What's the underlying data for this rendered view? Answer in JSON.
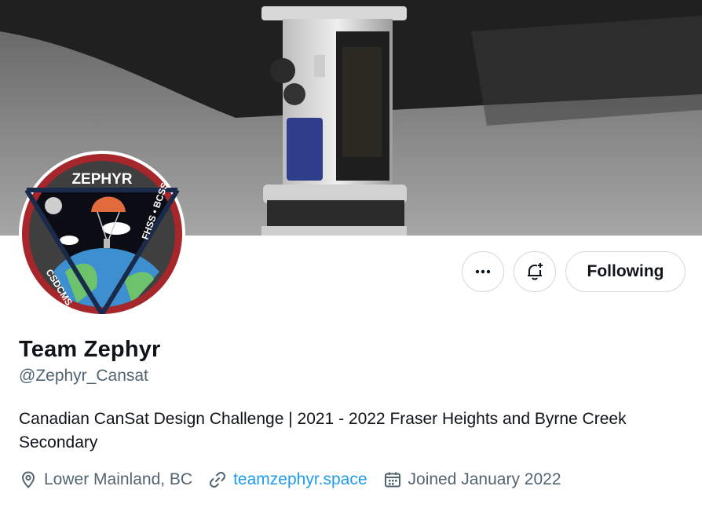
{
  "profile": {
    "display_name": "Team Zephyr",
    "handle": "@Zephyr_Cansat",
    "bio": "Canadian CanSat Design Challenge | 2021 - 2022 Fraser Heights and Byrne Creek Secondary",
    "location": "Lower Mainland, BC",
    "website": "teamzephyr.space",
    "joined": "Joined January 2022"
  },
  "actions": {
    "follow_label": "Following"
  },
  "avatar": {
    "badge_title": "ZEPHYR",
    "left_text": "CSDCMS",
    "right_text": "FHSS • BCSS"
  },
  "icons": {
    "more": "more-icon",
    "notify": "bell-plus-icon",
    "location": "location-pin-icon",
    "link": "link-icon",
    "calendar": "calendar-icon"
  },
  "colors": {
    "link": "#1d9bf0",
    "secondary_text": "#536471",
    "badge_red": "#a5262b"
  }
}
